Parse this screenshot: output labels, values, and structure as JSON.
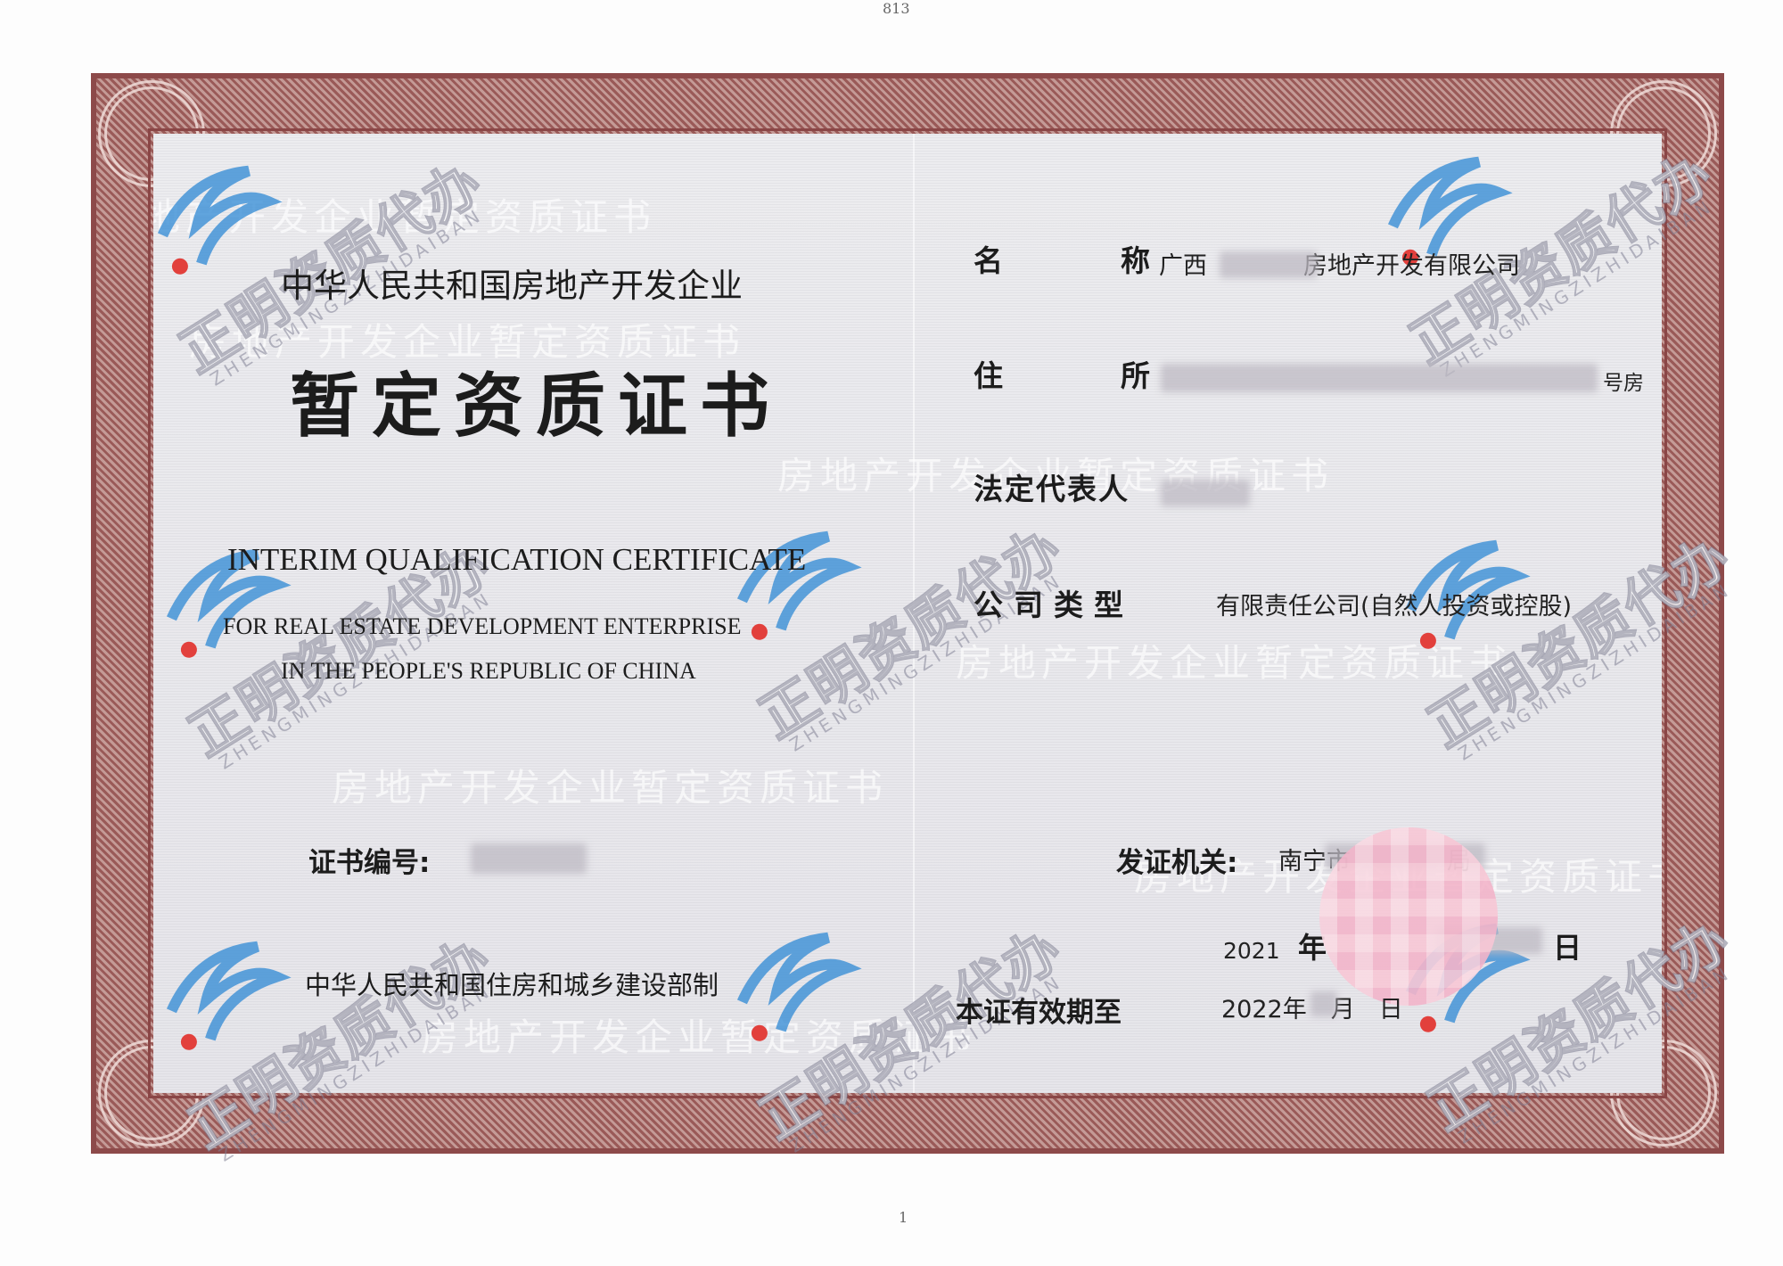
{
  "scan_marks": {
    "top": "813",
    "bottom": "1"
  },
  "certificate": {
    "subtitle": "中华人民共和国房地产开发企业",
    "title": "暂定资质证书",
    "english_title": "INTERIM QUALIFICATION CERTIFICATE",
    "english_subtitle_1": "FOR REAL ESTATE DEVELOPMENT ENTERPRISE",
    "english_subtitle_2": "IN THE PEOPLE'S REPUBLIC OF CHINA",
    "name_label": "名称",
    "name_value": "广西　　　　房地产开发有限公司",
    "address_label": "住所",
    "address_value": "号房",
    "legal_rep_label": "法定代表人",
    "company_type_label": "公司类型",
    "company_type_value": "有限责任公司(自然人投资或控股)",
    "cert_number_label": "证书编号:",
    "issuer_label": "发证机关:",
    "issuer_value": "南宁市　　　　局",
    "issue_year": "2021",
    "year_unit": "年",
    "day_unit": "日",
    "ministry": "中华人民共和国住房和城乡建设部制",
    "validity_label": "本证有效期至",
    "validity_value": "2022年　月　日"
  },
  "watermark": {
    "logo_text": "正明资质代办",
    "logo_pinyin": "ZHENGMINGZIZHIDAIBAN",
    "background_text": "房地产开发企业暂定资质证书"
  },
  "colors": {
    "frame": "#8d4a4a",
    "paper": "#e9e8ec",
    "logo_blue": "#3a8fd6",
    "logo_dot": "#e2403c"
  }
}
